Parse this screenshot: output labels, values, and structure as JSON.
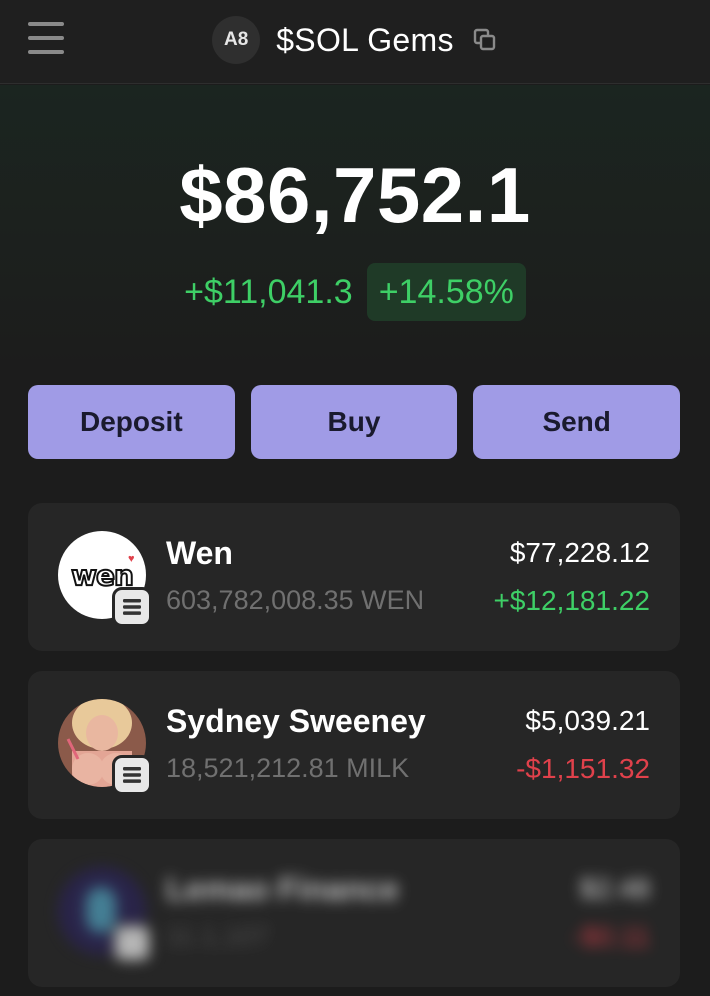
{
  "header": {
    "avatar_initials": "A8",
    "wallet_name": "$SOL Gems"
  },
  "portfolio": {
    "balance": "$86,752.1",
    "change_abs": "+$11,041.3",
    "change_pct": "+14.58%"
  },
  "actions": [
    {
      "label": "Deposit"
    },
    {
      "label": "Buy"
    },
    {
      "label": "Send"
    }
  ],
  "tokens": [
    {
      "name": "Wen",
      "amount": "603,782,008.35 WEN",
      "value": "$77,228.12",
      "change": "+$12,181.22",
      "logo_text": "wen"
    },
    {
      "name": "Sydney Sweeney",
      "amount": "18,521,212.81 MILK",
      "value": "$5,039.21",
      "change": "-$1,151.32"
    },
    {
      "name": "Lemao Finance",
      "amount": "11.1,107",
      "value": "$2.48",
      "change": "-$0.11"
    }
  ],
  "colors": {
    "accent": "#a09be6",
    "positive": "#3ecf66",
    "negative": "#e0414b",
    "background": "#1c1c1c",
    "card": "#262626"
  }
}
